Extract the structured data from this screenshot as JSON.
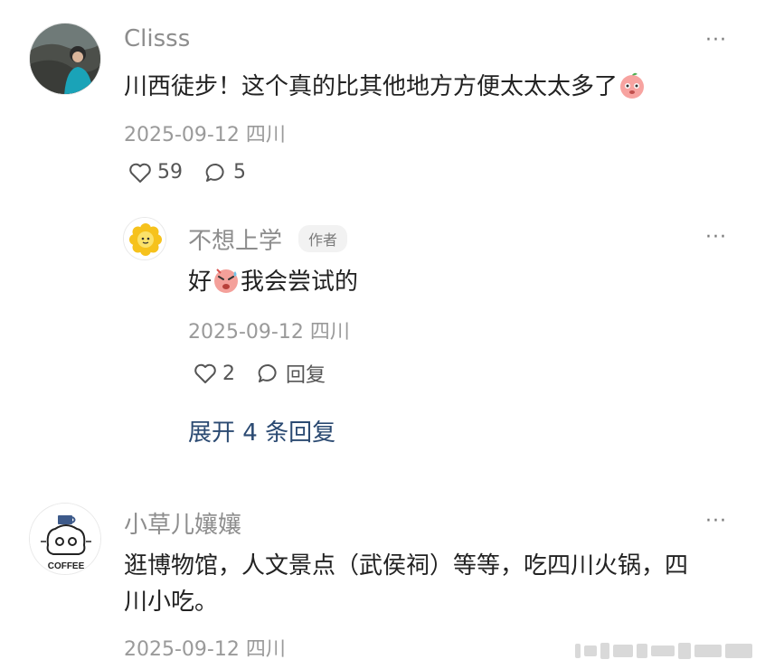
{
  "comments": [
    {
      "username": "Clisss",
      "text": "川西徒步！这个真的比其他地方方便太太太多了",
      "emoji": "peach-blush-emoji",
      "date_location": "2025-09-12 四川",
      "likes": "59",
      "replies": "5",
      "reply": {
        "username": "不想上学",
        "author_badge": "作者",
        "text_before": "好",
        "emoji": "sweat-face-emoji",
        "text_after": "我会尝试的",
        "date_location": "2025-09-12 四川",
        "likes": "2",
        "reply_label": "回复"
      },
      "expand_label": "展开 4 条回复"
    },
    {
      "username": "小草儿孃孃",
      "avatar_text": "COFFEE",
      "text_line1": "逛博物馆，人文景点（武侯祠）等等，吃四川火锅，四",
      "text_line2": "川小吃。",
      "date_location": "2025-09-12 四川"
    }
  ],
  "more_label": "···",
  "icons": {
    "like": "heart-outline-icon",
    "comment": "comment-bubble-icon",
    "more": "more-dots-icon"
  },
  "colors": {
    "username": "#8d8d8d",
    "meta": "#9a9a9a",
    "link": "#2b4a72",
    "badge_bg": "#f2f2f2"
  }
}
